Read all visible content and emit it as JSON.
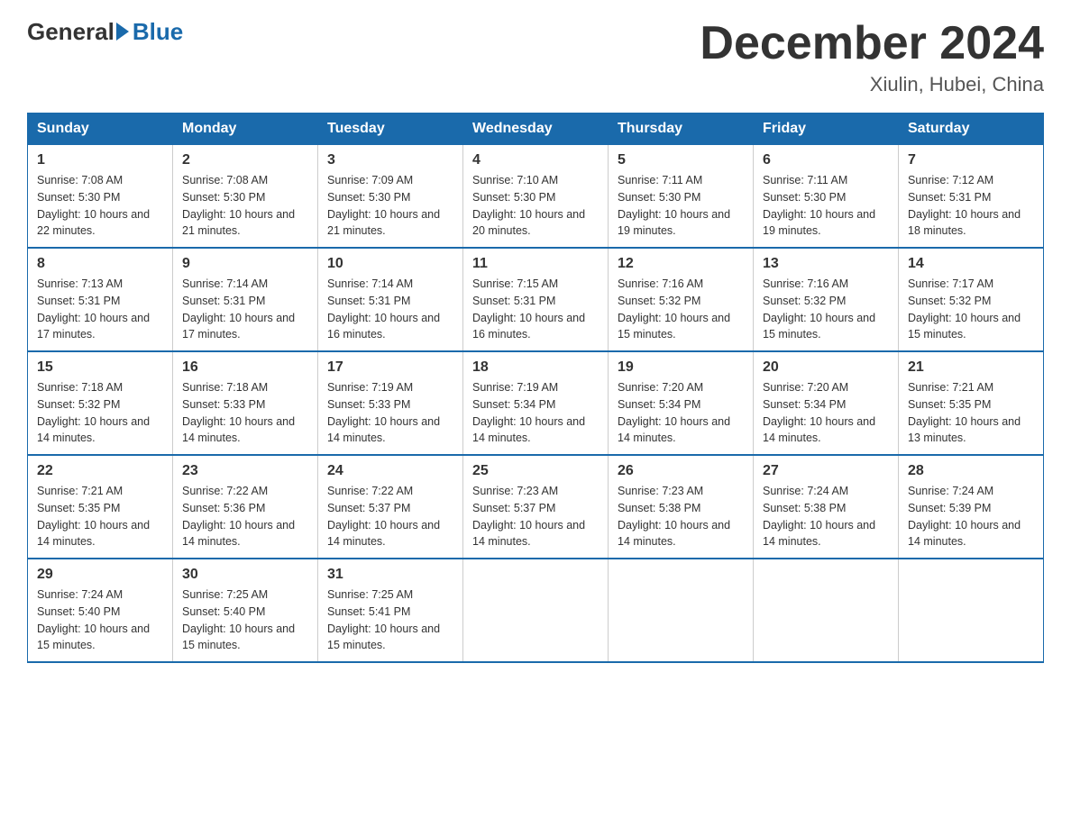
{
  "header": {
    "logo_general": "General",
    "logo_blue": "Blue",
    "title": "December 2024",
    "subtitle": "Xiulin, Hubei, China"
  },
  "days_of_week": [
    "Sunday",
    "Monday",
    "Tuesday",
    "Wednesday",
    "Thursday",
    "Friday",
    "Saturday"
  ],
  "weeks": [
    [
      {
        "day": "1",
        "sunrise": "7:08 AM",
        "sunset": "5:30 PM",
        "daylight": "10 hours and 22 minutes."
      },
      {
        "day": "2",
        "sunrise": "7:08 AM",
        "sunset": "5:30 PM",
        "daylight": "10 hours and 21 minutes."
      },
      {
        "day": "3",
        "sunrise": "7:09 AM",
        "sunset": "5:30 PM",
        "daylight": "10 hours and 21 minutes."
      },
      {
        "day": "4",
        "sunrise": "7:10 AM",
        "sunset": "5:30 PM",
        "daylight": "10 hours and 20 minutes."
      },
      {
        "day": "5",
        "sunrise": "7:11 AM",
        "sunset": "5:30 PM",
        "daylight": "10 hours and 19 minutes."
      },
      {
        "day": "6",
        "sunrise": "7:11 AM",
        "sunset": "5:30 PM",
        "daylight": "10 hours and 19 minutes."
      },
      {
        "day": "7",
        "sunrise": "7:12 AM",
        "sunset": "5:31 PM",
        "daylight": "10 hours and 18 minutes."
      }
    ],
    [
      {
        "day": "8",
        "sunrise": "7:13 AM",
        "sunset": "5:31 PM",
        "daylight": "10 hours and 17 minutes."
      },
      {
        "day": "9",
        "sunrise": "7:14 AM",
        "sunset": "5:31 PM",
        "daylight": "10 hours and 17 minutes."
      },
      {
        "day": "10",
        "sunrise": "7:14 AM",
        "sunset": "5:31 PM",
        "daylight": "10 hours and 16 minutes."
      },
      {
        "day": "11",
        "sunrise": "7:15 AM",
        "sunset": "5:31 PM",
        "daylight": "10 hours and 16 minutes."
      },
      {
        "day": "12",
        "sunrise": "7:16 AM",
        "sunset": "5:32 PM",
        "daylight": "10 hours and 15 minutes."
      },
      {
        "day": "13",
        "sunrise": "7:16 AM",
        "sunset": "5:32 PM",
        "daylight": "10 hours and 15 minutes."
      },
      {
        "day": "14",
        "sunrise": "7:17 AM",
        "sunset": "5:32 PM",
        "daylight": "10 hours and 15 minutes."
      }
    ],
    [
      {
        "day": "15",
        "sunrise": "7:18 AM",
        "sunset": "5:32 PM",
        "daylight": "10 hours and 14 minutes."
      },
      {
        "day": "16",
        "sunrise": "7:18 AM",
        "sunset": "5:33 PM",
        "daylight": "10 hours and 14 minutes."
      },
      {
        "day": "17",
        "sunrise": "7:19 AM",
        "sunset": "5:33 PM",
        "daylight": "10 hours and 14 minutes."
      },
      {
        "day": "18",
        "sunrise": "7:19 AM",
        "sunset": "5:34 PM",
        "daylight": "10 hours and 14 minutes."
      },
      {
        "day": "19",
        "sunrise": "7:20 AM",
        "sunset": "5:34 PM",
        "daylight": "10 hours and 14 minutes."
      },
      {
        "day": "20",
        "sunrise": "7:20 AM",
        "sunset": "5:34 PM",
        "daylight": "10 hours and 14 minutes."
      },
      {
        "day": "21",
        "sunrise": "7:21 AM",
        "sunset": "5:35 PM",
        "daylight": "10 hours and 13 minutes."
      }
    ],
    [
      {
        "day": "22",
        "sunrise": "7:21 AM",
        "sunset": "5:35 PM",
        "daylight": "10 hours and 14 minutes."
      },
      {
        "day": "23",
        "sunrise": "7:22 AM",
        "sunset": "5:36 PM",
        "daylight": "10 hours and 14 minutes."
      },
      {
        "day": "24",
        "sunrise": "7:22 AM",
        "sunset": "5:37 PM",
        "daylight": "10 hours and 14 minutes."
      },
      {
        "day": "25",
        "sunrise": "7:23 AM",
        "sunset": "5:37 PM",
        "daylight": "10 hours and 14 minutes."
      },
      {
        "day": "26",
        "sunrise": "7:23 AM",
        "sunset": "5:38 PM",
        "daylight": "10 hours and 14 minutes."
      },
      {
        "day": "27",
        "sunrise": "7:24 AM",
        "sunset": "5:38 PM",
        "daylight": "10 hours and 14 minutes."
      },
      {
        "day": "28",
        "sunrise": "7:24 AM",
        "sunset": "5:39 PM",
        "daylight": "10 hours and 14 minutes."
      }
    ],
    [
      {
        "day": "29",
        "sunrise": "7:24 AM",
        "sunset": "5:40 PM",
        "daylight": "10 hours and 15 minutes."
      },
      {
        "day": "30",
        "sunrise": "7:25 AM",
        "sunset": "5:40 PM",
        "daylight": "10 hours and 15 minutes."
      },
      {
        "day": "31",
        "sunrise": "7:25 AM",
        "sunset": "5:41 PM",
        "daylight": "10 hours and 15 minutes."
      },
      null,
      null,
      null,
      null
    ]
  ],
  "labels": {
    "sunrise_prefix": "Sunrise: ",
    "sunset_prefix": "Sunset: ",
    "daylight_prefix": "Daylight: "
  }
}
